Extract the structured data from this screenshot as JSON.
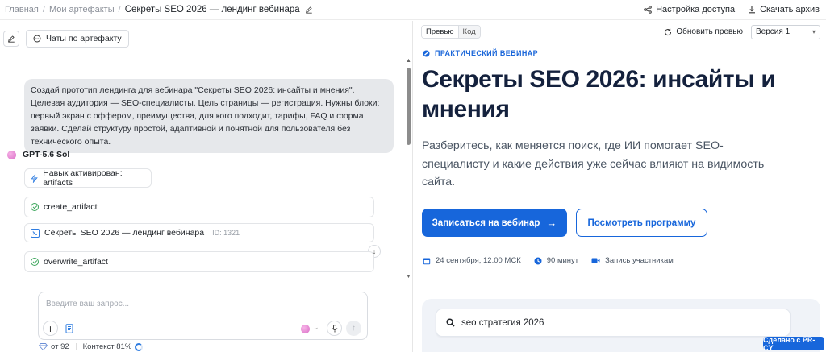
{
  "breadcrumb": {
    "home": "Главная",
    "artifacts": "Мои артефакты",
    "current": "Секреты SEO 2026 — лендинг вебинара"
  },
  "top_actions": {
    "share": "Настройка доступа",
    "download": "Скачать архив"
  },
  "left_toolbar": {
    "chat_button": "Чаты по артефакту"
  },
  "conversation": {
    "user_message": "Создай прототип лендинга для вебинара \"Секреты SEO 2026: инсайты и мнения\". Целевая аудитория — SEO-специалисты. Цель страницы — регистрация. Нужны блоки: первый экран с оффером, преимущества, для кого подходит, тарифы, FAQ и форма заявки. Сделай структуру простой, адаптивной и понятной для пользователя без технического опыта.",
    "model_name": "GPT-5.6 Sol",
    "skill": "Навык активирован: artifacts",
    "tool1": "create_artifact",
    "artifact_title": "Секреты SEO 2026 — лендинг вебинара",
    "artifact_id": "ID: 1321",
    "tool2": "overwrite_artifact"
  },
  "composer": {
    "placeholder": "Введите ваш запрос..."
  },
  "footer": {
    "cost": "от 92",
    "context": "Контекст 81%"
  },
  "preview_toolbar": {
    "tab_preview": "Превью",
    "tab_code": "Код",
    "refresh": "Обновить превью",
    "version": "Версия 1"
  },
  "landing": {
    "kicker": "ПРАКТИЧЕСКИЙ ВЕБИНАР",
    "title": "Секреты SEO 2026: инсайты и мнения",
    "lead": "Разберитесь, как меняется поиск, где ИИ помогает SEO-специалисту и какие действия уже сейчас влияют на видимость сайта.",
    "cta_primary": "Записаться на вебинар",
    "cta_secondary": "Посмотреть программу",
    "meta_date": "24 сентября, 12:00 МСК",
    "meta_duration": "90 минут",
    "meta_recording": "Запись участникам",
    "search_text": "seo стратегия 2026"
  },
  "badge": "Сделано с PR-CY",
  "colors": {
    "accent": "#1766db",
    "title": "#14213d"
  }
}
